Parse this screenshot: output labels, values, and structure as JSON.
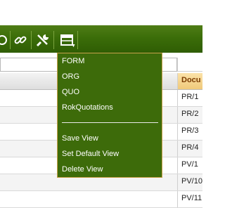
{
  "toolbar": {
    "icons": [
      "circle-icon",
      "link-icon",
      "tools-icon",
      "view-icon"
    ],
    "accent": "#3b6d09"
  },
  "grid": {
    "document_header": "Docu",
    "document_values": [
      "PR/1",
      "PR/2",
      "PR/3",
      "PR/4",
      "PV/1",
      "PV/10",
      "PV/11"
    ]
  },
  "view_menu": {
    "items": [
      "FORM",
      "ORG",
      "QUO",
      "RokQuotations"
    ],
    "actions": [
      "Save View",
      "Set Default View",
      "Delete View"
    ],
    "background": "#3d6b0a",
    "border": "#c9a14a"
  }
}
